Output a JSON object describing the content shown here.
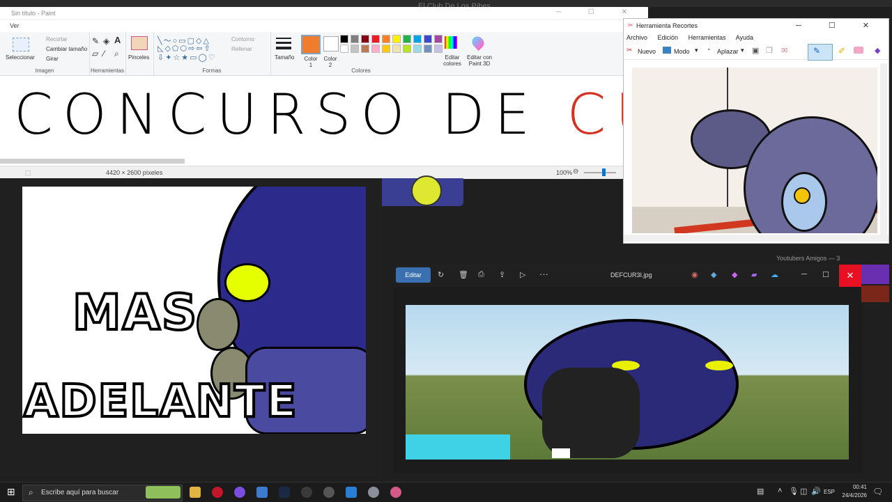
{
  "background": {
    "title": "El Club De Los Pibes"
  },
  "paint": {
    "title": "Sin título - Paint",
    "menu": "Ver",
    "groups": {
      "image": {
        "label": "Imagen",
        "select": "Seleccionar",
        "crop": "Recortar",
        "resize": "Cambiar tamaño",
        "rotate": "Girar"
      },
      "tools": {
        "label": "Herramientas"
      },
      "brushes": {
        "label": "Pinceles"
      },
      "shapes": {
        "label": "Formas",
        "outline": "Contorno",
        "fill": "Rellenar"
      },
      "size": {
        "label": "Tamaño"
      },
      "colors": {
        "label": "Colores",
        "color1": "Color 1",
        "color2": "Color 2",
        "edit": "Editar colores",
        "paint3d": "Editar con Paint 3D"
      }
    },
    "canvas_text_black": "CONCURSO DE",
    "canvas_text_red": "CURIS",
    "status": {
      "dimensions": "4420 × 2600 píxeles",
      "zoom": "100%"
    },
    "palette": [
      "#000000",
      "#7f7f7f",
      "#880015",
      "#ed1c24",
      "#ff7f27",
      "#fff200",
      "#22b14c",
      "#00a2e8",
      "#3f48cc",
      "#a349a4",
      "#ffffff",
      "#c3c3c3",
      "#b97a57",
      "#ffaec9",
      "#ffc90e",
      "#efe4b0",
      "#b5e61d",
      "#99d9ea",
      "#7092be",
      "#c8bfe7"
    ],
    "active_color": "#f07c2e"
  },
  "left_image": {
    "line1": "MAS",
    "line2": "ADELANTE"
  },
  "snipping": {
    "title": "Herramienta Recortes",
    "menu": [
      "Archivo",
      "Edición",
      "Herramientas",
      "Ayuda"
    ],
    "toolbar": {
      "new": "Nuevo",
      "mode": "Modo",
      "delay": "Aplazar"
    }
  },
  "photos": {
    "edit": "Editar",
    "filename": "DEFCUR3I.jpg"
  },
  "side_label": "Youtubers Amigos — 3",
  "taskbar": {
    "search": "Escribe aquí para buscar",
    "lang": "ESP",
    "time": "00:41",
    "date": "24/4/2026"
  }
}
